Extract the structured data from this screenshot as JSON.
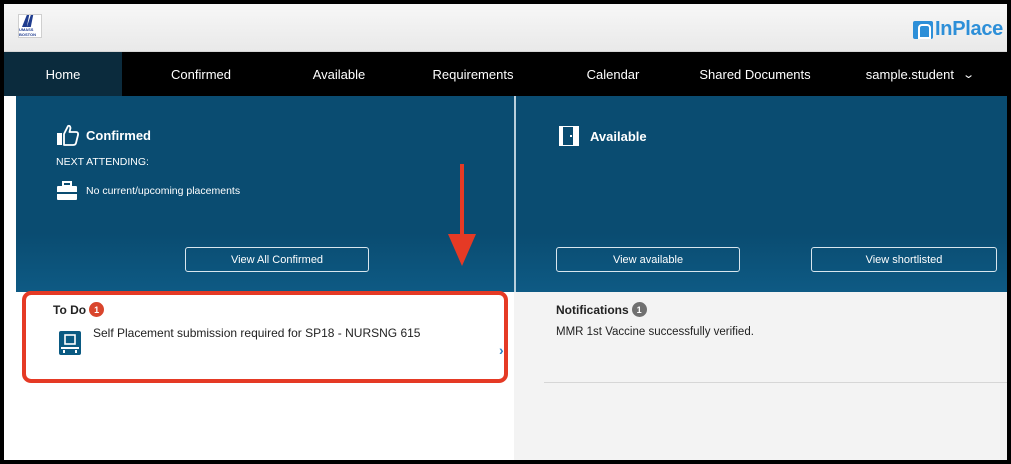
{
  "header": {
    "logo_text": "UMASS BOSTON",
    "brand": "InPlace"
  },
  "nav": {
    "items": [
      "Home",
      "Confirmed",
      "Available",
      "Requirements",
      "Calendar",
      "Shared Documents"
    ],
    "user": "sample.student"
  },
  "confirmed_panel": {
    "title": "Confirmed",
    "next_attending_label": "NEXT ATTENDING:",
    "placement_text": "No current/upcoming placements",
    "button": "View All Confirmed"
  },
  "available_panel": {
    "title": "Available",
    "button_available": "View available",
    "button_shortlisted": "View shortlisted"
  },
  "todo": {
    "title": "To Do",
    "count": "1",
    "item_text": "Self Placement submission required for SP18 - NURSNG 615"
  },
  "notifications": {
    "title": "Notifications",
    "count": "1",
    "item_text": "MMR 1st Vaccine successfully verified."
  },
  "colors": {
    "hero": "#0a4c71",
    "nav_active": "#0b2b3d",
    "highlight": "#e53a25",
    "brand": "#2d8fd8"
  }
}
